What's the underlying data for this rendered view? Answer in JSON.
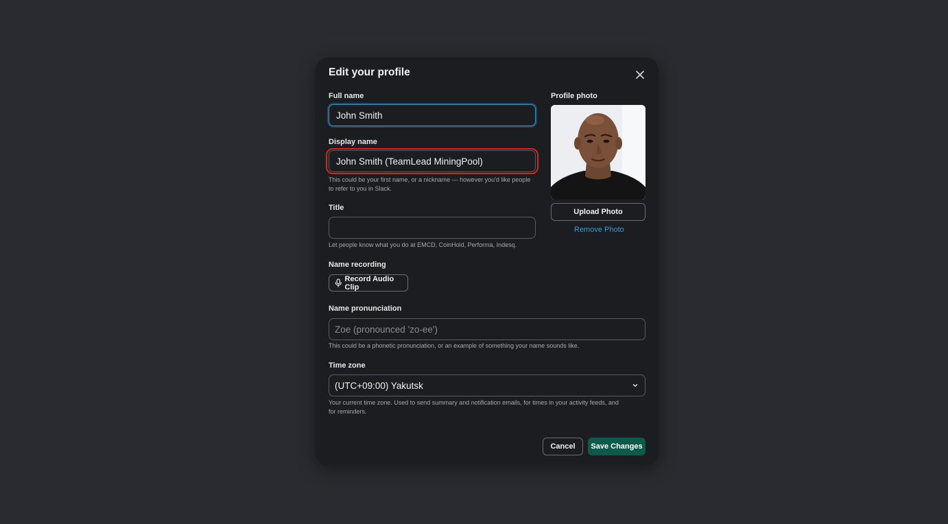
{
  "modal": {
    "title": "Edit your profile"
  },
  "full_name": {
    "label": "Full name",
    "value": "John Smith"
  },
  "display_name": {
    "label": "Display name",
    "value": "John Smith (TeamLead MiningPool)",
    "hint_line1": "This could be your first name, or a nickname — however you'd like people",
    "hint_line2": "to refer to you in Slack."
  },
  "title_field": {
    "label": "Title",
    "value": "",
    "hint": "Let people know what you do at EMCD, CoinHold, Performa, Indesq."
  },
  "name_recording": {
    "label": "Name recording",
    "button_label": "Record Audio Clip",
    "icon": "microphone-icon"
  },
  "name_pronunciation": {
    "label": "Name pronunciation",
    "placeholder": "Zoe (pronounced 'zo-ee')",
    "hint": "This could be a phonetic pronunciation, or an example of something your name sounds like."
  },
  "time_zone": {
    "label": "Time zone",
    "selected": "(UTC+09:00) Yakutsk",
    "hint_line1": "Your current time zone. Used to send summary and notification emails, for times in your activity feeds, and",
    "hint_line2": "for reminders."
  },
  "profile_photo": {
    "label": "Profile photo",
    "upload_label": "Upload Photo",
    "remove_label": "Remove Photo"
  },
  "footer": {
    "cancel_label": "Cancel",
    "save_label": "Save Changes"
  },
  "colors": {
    "backdrop": "#2a2b30",
    "modal": "#1b1d21",
    "focus_ring": "#1d6ea0",
    "highlight": "#d4241f",
    "link": "#3a9ad9",
    "primary": "#0e5a4a"
  }
}
